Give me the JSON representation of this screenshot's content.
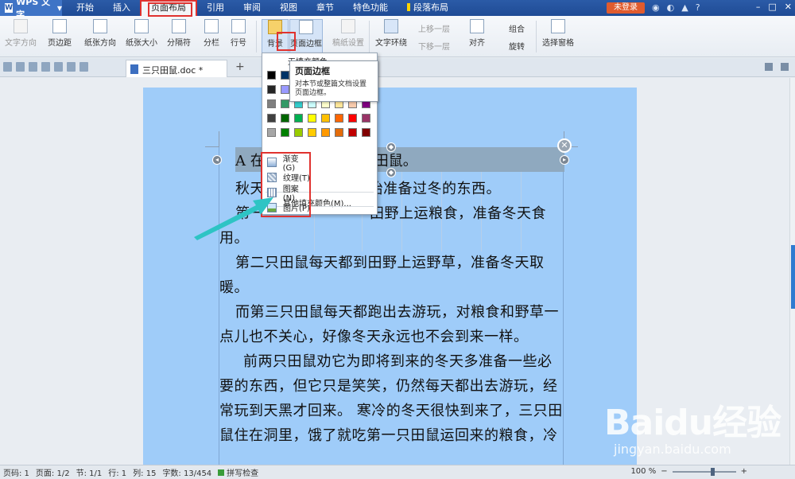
{
  "app": {
    "name": "WPS 文字"
  },
  "menu": {
    "tabs": [
      {
        "label": "开始"
      },
      {
        "label": "插入"
      },
      {
        "label": "页面布局"
      },
      {
        "label": "引用"
      },
      {
        "label": "审阅"
      },
      {
        "label": "视图"
      },
      {
        "label": "章节"
      },
      {
        "label": "特色功能"
      },
      {
        "label": "段落布局"
      }
    ],
    "active_tab": "页面布局",
    "login_label": "未登录",
    "help_icon": "?"
  },
  "ribbon": {
    "text_direction": "文字方向",
    "margins": "页边距",
    "orientation": "纸张方向",
    "size": "纸张大小",
    "columns": "分栏",
    "separator": "分隔符",
    "line_number": "行号",
    "background": "背景",
    "page_border": "页面边框",
    "paper_setup": "稿纸设置",
    "text_wrap": "文字环绕",
    "bring_forward": "上移一层",
    "send_backward": "下移一层",
    "align": "对齐",
    "group": "组合",
    "rotate": "旋转",
    "selection_pane": "选择窗格"
  },
  "document_tab": {
    "filename": "三只田鼠.doc *"
  },
  "background_menu": {
    "header": "无填充颜色",
    "more_colors": "其他填充颜色(M)...",
    "swatch_colors": [
      "#000000",
      "#003366",
      "#1f3864",
      "#17365d",
      "#366092",
      "#4f81bd",
      "#0000ff",
      "#7030a0",
      "#262626",
      "#9999ff",
      "#00ccff",
      "#66ffcc",
      "#ccffcc",
      "#ffff99",
      "#ffcc99",
      "#cc99ff",
      "#7f7f7f",
      "#339966",
      "#33cccc",
      "#ccffff",
      "#ffffcc",
      "#ffe699",
      "#f8cbad",
      "#800080",
      "#404040",
      "#006600",
      "#00b050",
      "#ffff00",
      "#ffc000",
      "#ff6600",
      "#ff0000",
      "#993366",
      "#a6a6a6",
      "#008000",
      "#99cc00",
      "#ffcc00",
      "#ff9900",
      "#e36c0a",
      "#c00000",
      "#800000"
    ],
    "fill_items": [
      {
        "label": "渐变(G)"
      },
      {
        "label": "纹理(T)"
      },
      {
        "label": "图案(N)"
      },
      {
        "label": "图片(P)"
      }
    ]
  },
  "tooltip": {
    "title": "页面边框",
    "description": "对本节或整篇文档设置页面边框。"
  },
  "document": {
    "title": "A 在田野里住着三只田鼠。",
    "title_visible": "A 在",
    "title_visible_tail": "只田鼠。",
    "paragraphs": [
      "秋天到了，田鼠们开始准备过冬的东西。",
      "第一只田鼠每天都到田野上运粮食，准备冬天食用。",
      "第二只田鼠每天都到田野上运野草，准备冬天取暖。",
      "而第三只田鼠每天都跑出去游玩，对粮食和野草一点儿也不关心，好像冬天永远也不会到来一样。",
      "前两只田鼠劝它为即将到来的冬天多准备一些必要的东西，但它只是笑笑，仍然每天都出去游玩，经常玩到天黑才回来。 寒冷的冬天很快到来了，三只田鼠住在洞里，饿了就吃第一只田鼠运回来的粮食，冷"
    ],
    "visible_lines": [
      "秋天",
      "开始准备过冬的东西。",
      "第一",
      "田野上运粮食，准备冬天食",
      "用。",
      "第二只田鼠每天都到田野上运野草，准备冬天取",
      "暖。",
      "而第三只田鼠每天都跑出去游玩，对粮食和野草一",
      "点儿也不关心，好像冬天永远也不会到来一样。",
      "前两只田鼠劝它为即将到来的冬天多准备一些必",
      "要的东西，但它只是笑笑，仍然每天都出去游玩，经",
      "常玩到天黑才回来。 寒冷的冬天很快到来了，三只田",
      "鼠住在洞里，饿了就吃第一只田鼠运回来的粮食，冷"
    ]
  },
  "status": {
    "page_code": "页码: 1",
    "pages": "页面: 1/2",
    "section": "节: 1/1",
    "row": "行: 1",
    "column": "列: 15",
    "word_count": "字数: 13/454",
    "spell_check": "拼写检查",
    "zoom": "100 %"
  },
  "watermark": {
    "brand": "Baidu经验",
    "url": "jingyan.baidu.com"
  },
  "colors": {
    "title_bar": "#2b5ba7",
    "highlight_red": "#e0322f",
    "page_background": "#9fccf9",
    "arrow": "#2ec4c4"
  }
}
